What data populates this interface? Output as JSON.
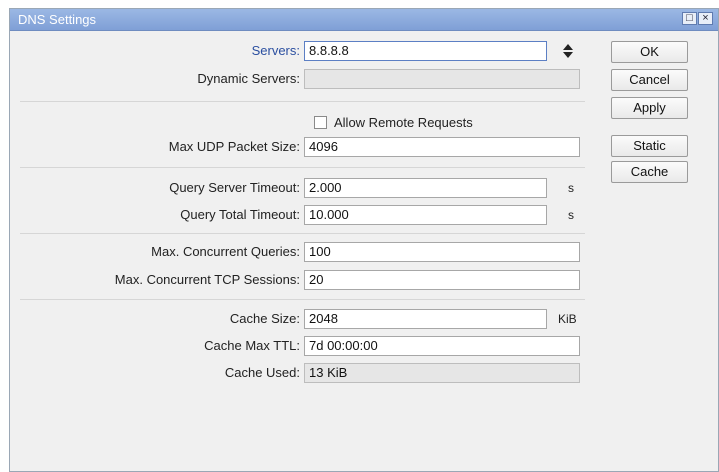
{
  "window": {
    "title": "DNS Settings",
    "restore_glyph": "□",
    "close_glyph": "×"
  },
  "fields": {
    "servers": {
      "label": "Servers:",
      "value": "8.8.8.8"
    },
    "dynamic_servers": {
      "label": "Dynamic Servers:",
      "value": ""
    },
    "allow_remote": {
      "label": "Allow Remote Requests",
      "checked": false
    },
    "max_udp": {
      "label": "Max UDP Packet Size:",
      "value": "4096"
    },
    "query_server_timeout": {
      "label": "Query Server Timeout:",
      "value": "2.000",
      "unit": "s"
    },
    "query_total_timeout": {
      "label": "Query Total Timeout:",
      "value": "10.000",
      "unit": "s"
    },
    "max_concurrent_queries": {
      "label": "Max. Concurrent Queries:",
      "value": "100"
    },
    "max_concurrent_tcp": {
      "label": "Max. Concurrent TCP Sessions:",
      "value": "20"
    },
    "cache_size": {
      "label": "Cache Size:",
      "value": "2048",
      "unit": "KiB"
    },
    "cache_max_ttl": {
      "label": "Cache Max TTL:",
      "value": "7d 00:00:00"
    },
    "cache_used": {
      "label": "Cache Used:",
      "value": "13 KiB"
    }
  },
  "buttons": {
    "ok": "OK",
    "cancel": "Cancel",
    "apply": "Apply",
    "static": "Static",
    "cache": "Cache"
  },
  "icons": {
    "spinner": "updown-arrows-icon"
  },
  "colors": {
    "titlebar": "#8aa9dc",
    "accent_label": "#2b4fa0"
  }
}
